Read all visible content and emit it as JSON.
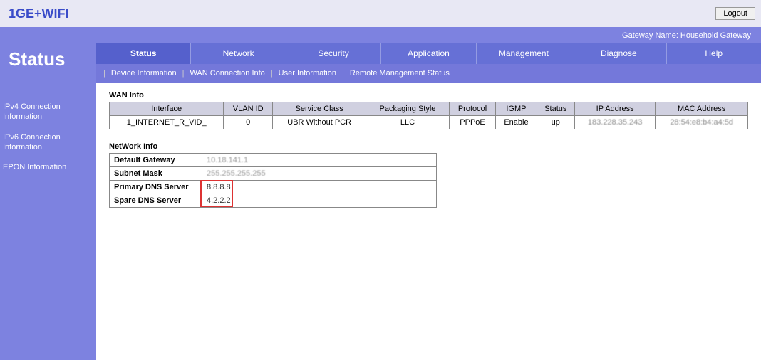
{
  "brand": "1GE+WIFI",
  "logout": "Logout",
  "gateway_name": "Gateway Name: Household Gateway",
  "page_title": "Status",
  "tabs": [
    "Status",
    "Network",
    "Security",
    "Application",
    "Management",
    "Diagnose",
    "Help"
  ],
  "subtabs": [
    "Device Information",
    "WAN Connection Info",
    "User Information",
    "Remote Management Status"
  ],
  "sidebar": {
    "items": [
      {
        "label": "IPv4 Connection Information"
      },
      {
        "label": "IPv6 Connection Information"
      },
      {
        "label": "EPON Information"
      }
    ]
  },
  "wan": {
    "title": "WAN Info",
    "headers": [
      "Interface",
      "VLAN ID",
      "Service Class",
      "Packaging Style",
      "Protocol",
      "IGMP",
      "Status",
      "IP Address",
      "MAC Address"
    ],
    "row": {
      "interface": "1_INTERNET_R_VID_",
      "vlan": "0",
      "service": "UBR Without PCR",
      "packaging": "LLC",
      "protocol": "PPPoE",
      "igmp": "Enable",
      "status": "up",
      "ip": "183.228.35.243",
      "mac": "28:54:e8:b4:a4:5d"
    }
  },
  "network": {
    "title": "NetWork Info",
    "default_gateway_label": "Default Gateway",
    "default_gateway": "10.18.141.1",
    "subnet_label": "Subnet Mask",
    "subnet": "255.255.255.255",
    "primary_dns_label": "Primary DNS Server",
    "primary_dns": "8.8.8.8",
    "spare_dns_label": "Spare DNS Server",
    "spare_dns": "4.2.2.2"
  }
}
